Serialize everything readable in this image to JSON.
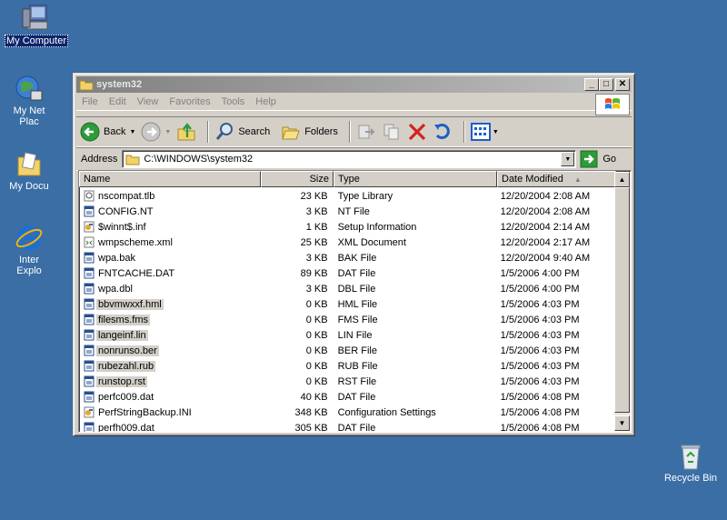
{
  "desktop": {
    "icons": [
      {
        "label": "My Computer"
      },
      {
        "label": "My Network Places"
      },
      {
        "label": "My Documents"
      },
      {
        "label": "Internet Explorer"
      },
      {
        "label": "Recycle Bin"
      }
    ],
    "visible_labels": {
      "my_computer": "My Computer",
      "net_line1": "My Net",
      "net_line2": "Plac",
      "docs": "My Docu",
      "ie_line1": "Inter",
      "ie_line2": "Explo",
      "recycle": "Recycle Bin"
    }
  },
  "window": {
    "title": "system32",
    "menu": [
      "File",
      "Edit",
      "View",
      "Favorites",
      "Tools",
      "Help"
    ],
    "toolbar": {
      "back_label": "Back",
      "search_label": "Search",
      "folders_label": "Folders"
    },
    "address": {
      "label": "Address",
      "value": "C:\\WINDOWS\\system32",
      "go_label": "Go"
    },
    "columns": {
      "name": "Name",
      "size": "Size",
      "type": "Type",
      "date": "Date Modified"
    },
    "files": [
      {
        "name": "nscompat.tlb",
        "size": "23 KB",
        "type": "Type Library",
        "date": "12/20/2004 2:08 AM",
        "icon": "tlb-icon",
        "hl": false
      },
      {
        "name": "CONFIG.NT",
        "size": "3 KB",
        "type": "NT File",
        "date": "12/20/2004 2:08 AM",
        "icon": "file-icon",
        "hl": false
      },
      {
        "name": "$winnt$.inf",
        "size": "1 KB",
        "type": "Setup Information",
        "date": "12/20/2004 2:14 AM",
        "icon": "inf-icon",
        "hl": false
      },
      {
        "name": "wmpscheme.xml",
        "size": "25 KB",
        "type": "XML Document",
        "date": "12/20/2004 2:17 AM",
        "icon": "xml-icon",
        "hl": false
      },
      {
        "name": "wpa.bak",
        "size": "3 KB",
        "type": "BAK File",
        "date": "12/20/2004 9:40 AM",
        "icon": "file-icon",
        "hl": false
      },
      {
        "name": "FNTCACHE.DAT",
        "size": "89 KB",
        "type": "DAT File",
        "date": "1/5/2006 4:00 PM",
        "icon": "file-icon",
        "hl": false
      },
      {
        "name": "wpa.dbl",
        "size": "3 KB",
        "type": "DBL File",
        "date": "1/5/2006 4:00 PM",
        "icon": "file-icon",
        "hl": false
      },
      {
        "name": "bbvmwxxf.hml",
        "size": "0 KB",
        "type": "HML File",
        "date": "1/5/2006 4:03 PM",
        "icon": "file-icon",
        "hl": true
      },
      {
        "name": "filesms.fms",
        "size": "0 KB",
        "type": "FMS File",
        "date": "1/5/2006 4:03 PM",
        "icon": "file-icon",
        "hl": true
      },
      {
        "name": "langeinf.lin",
        "size": "0 KB",
        "type": "LIN File",
        "date": "1/5/2006 4:03 PM",
        "icon": "file-icon",
        "hl": true
      },
      {
        "name": "nonrunso.ber",
        "size": "0 KB",
        "type": "BER File",
        "date": "1/5/2006 4:03 PM",
        "icon": "file-icon",
        "hl": true
      },
      {
        "name": "rubezahl.rub",
        "size": "0 KB",
        "type": "RUB File",
        "date": "1/5/2006 4:03 PM",
        "icon": "file-icon",
        "hl": true
      },
      {
        "name": "runstop.rst",
        "size": "0 KB",
        "type": "RST File",
        "date": "1/5/2006 4:03 PM",
        "icon": "file-icon",
        "hl": true
      },
      {
        "name": "perfc009.dat",
        "size": "40 KB",
        "type": "DAT File",
        "date": "1/5/2006 4:08 PM",
        "icon": "file-icon",
        "hl": false
      },
      {
        "name": "PerfStringBackup.INI",
        "size": "348 KB",
        "type": "Configuration Settings",
        "date": "1/5/2006 4:08 PM",
        "icon": "inf-icon",
        "hl": false
      },
      {
        "name": "perfh009.dat",
        "size": "305 KB",
        "type": "DAT File",
        "date": "1/5/2006 4:08 PM",
        "icon": "file-icon",
        "hl": false
      }
    ]
  }
}
